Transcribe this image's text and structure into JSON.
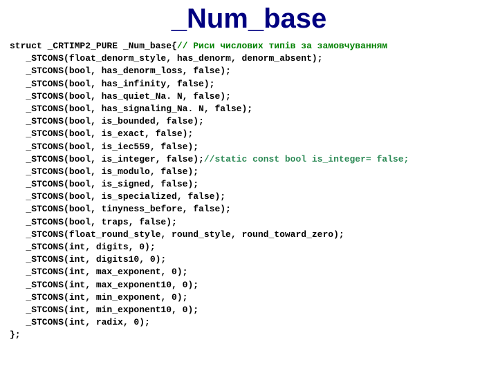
{
  "title": "_Num_base",
  "code": {
    "struct_open": "struct _CRTIMP2_PURE _Num_base{",
    "comment_header": "// Риси числових типів за замовчуванням",
    "lines": [
      "   _STCONS(float_denorm_style, has_denorm, denorm_absent);",
      "   _STCONS(bool, has_denorm_loss, false);",
      "   _STCONS(bool, has_infinity, false);",
      "   _STCONS(bool, has_quiet_Na. N, false);",
      "   _STCONS(bool, has_signaling_Na. N, false);",
      "   _STCONS(bool, is_bounded, false);",
      "   _STCONS(bool, is_exact, false);",
      "   _STCONS(bool, is_iec559, false);"
    ],
    "line_is_integer": "   _STCONS(bool, is_integer, false);",
    "comment_is_integer": "//static const bool is_integer= false;",
    "lines2": [
      "   _STCONS(bool, is_modulo, false);",
      "   _STCONS(bool, is_signed, false);",
      "   _STCONS(bool, is_specialized, false);",
      "   _STCONS(bool, tinyness_before, false);",
      "   _STCONS(bool, traps, false);",
      "   _STCONS(float_round_style, round_style, round_toward_zero);",
      "   _STCONS(int, digits, 0);",
      "   _STCONS(int, digits10, 0);",
      "   _STCONS(int, max_exponent, 0);",
      "   _STCONS(int, max_exponent10, 0);",
      "   _STCONS(int, min_exponent, 0);",
      "   _STCONS(int, min_exponent10, 0);",
      "   _STCONS(int, radix, 0);"
    ],
    "struct_close": "};"
  }
}
